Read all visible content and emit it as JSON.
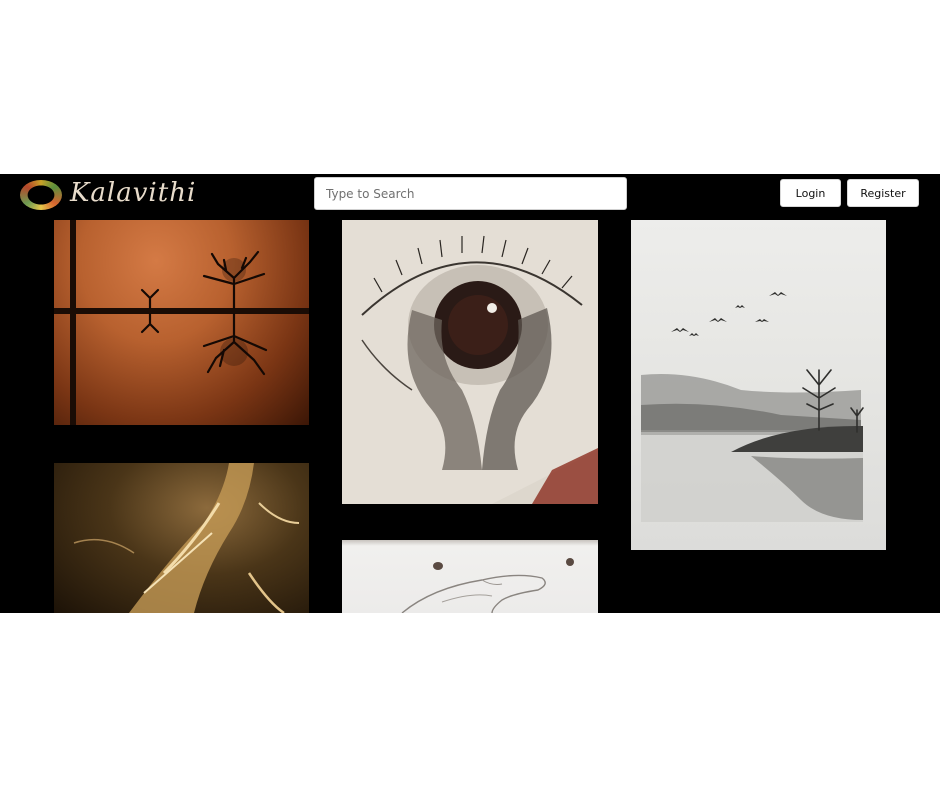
{
  "header": {
    "logo_text": "Kalavithi",
    "search": {
      "placeholder": "Type to Search",
      "value": ""
    },
    "login_label": "Login",
    "register_label": "Register"
  },
  "gallery": {
    "items": [
      {
        "subject": "tree-silhouette-painting"
      },
      {
        "subject": "eye-hands-sketch"
      },
      {
        "subject": "misty-lake-landscape"
      },
      {
        "subject": "golden-figure-painting"
      },
      {
        "subject": "hand-pencil-sketch"
      }
    ]
  },
  "colors": {
    "app_background": "#000000",
    "page_background": "#ffffff",
    "button_background": "#ffffff",
    "logo_text": "#e8dccb"
  }
}
